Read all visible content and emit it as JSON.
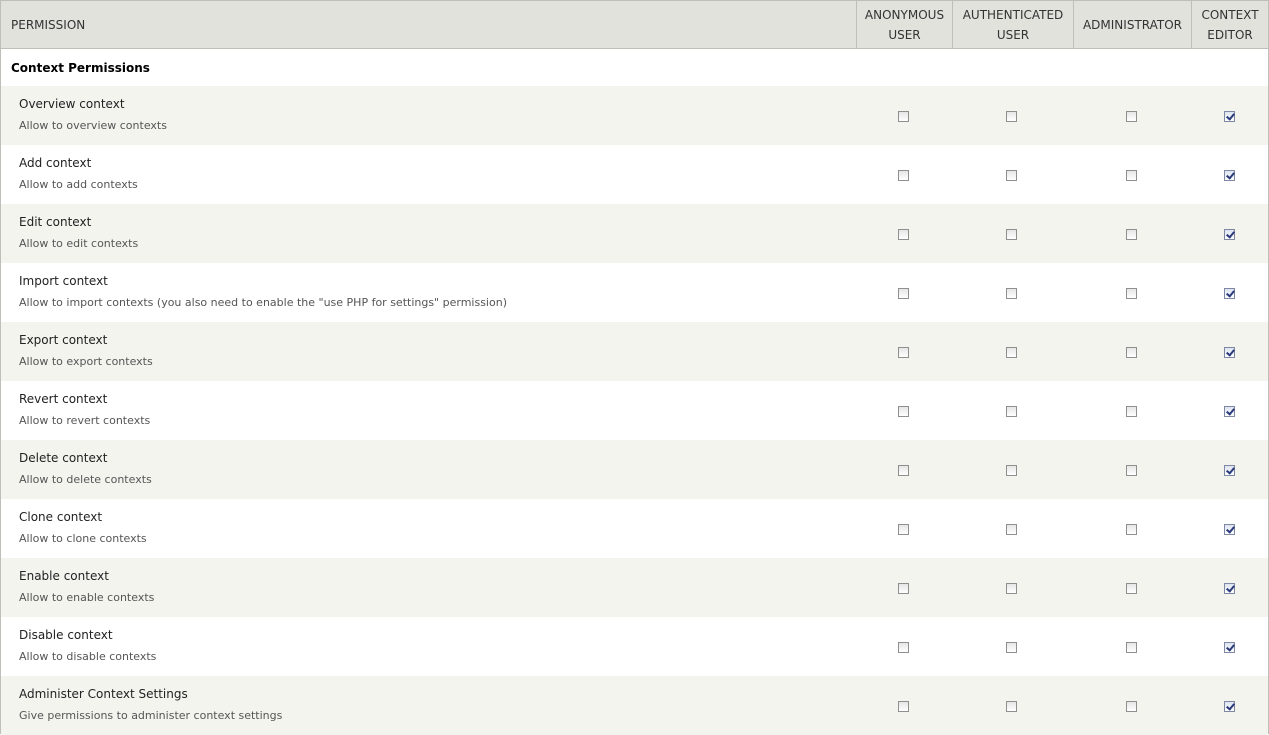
{
  "header": {
    "permission": "PERMISSION",
    "anonymous": "ANONYMOUS\nUSER",
    "authenticated": "AUTHENTICATED\nUSER",
    "administrator": "ADMINISTRATOR",
    "context_editor": "CONTEXT\nEDITOR"
  },
  "module": {
    "title": "Context Permissions"
  },
  "permissions": [
    {
      "name": "Overview context",
      "description": "Allow to overview contexts",
      "anonymous": false,
      "authenticated": false,
      "administrator": false,
      "context_editor": true
    },
    {
      "name": "Add context",
      "description": "Allow to add contexts",
      "anonymous": false,
      "authenticated": false,
      "administrator": false,
      "context_editor": true
    },
    {
      "name": "Edit context",
      "description": "Allow to edit contexts",
      "anonymous": false,
      "authenticated": false,
      "administrator": false,
      "context_editor": true
    },
    {
      "name": "Import context",
      "description": "Allow to import contexts (you also need to enable the \"use PHP for settings\" permission)",
      "anonymous": false,
      "authenticated": false,
      "administrator": false,
      "context_editor": true
    },
    {
      "name": "Export context",
      "description": "Allow to export contexts",
      "anonymous": false,
      "authenticated": false,
      "administrator": false,
      "context_editor": true
    },
    {
      "name": "Revert context",
      "description": "Allow to revert contexts",
      "anonymous": false,
      "authenticated": false,
      "administrator": false,
      "context_editor": true
    },
    {
      "name": "Delete context",
      "description": "Allow to delete contexts",
      "anonymous": false,
      "authenticated": false,
      "administrator": false,
      "context_editor": true
    },
    {
      "name": "Clone context",
      "description": "Allow to clone contexts",
      "anonymous": false,
      "authenticated": false,
      "administrator": false,
      "context_editor": true
    },
    {
      "name": "Enable context",
      "description": "Allow to enable contexts",
      "anonymous": false,
      "authenticated": false,
      "administrator": false,
      "context_editor": true
    },
    {
      "name": "Disable context",
      "description": "Allow to disable contexts",
      "anonymous": false,
      "authenticated": false,
      "administrator": false,
      "context_editor": true
    },
    {
      "name": "Administer Context Settings",
      "description": "Give permissions to administer context settings",
      "anonymous": false,
      "authenticated": false,
      "administrator": false,
      "context_editor": true
    }
  ]
}
